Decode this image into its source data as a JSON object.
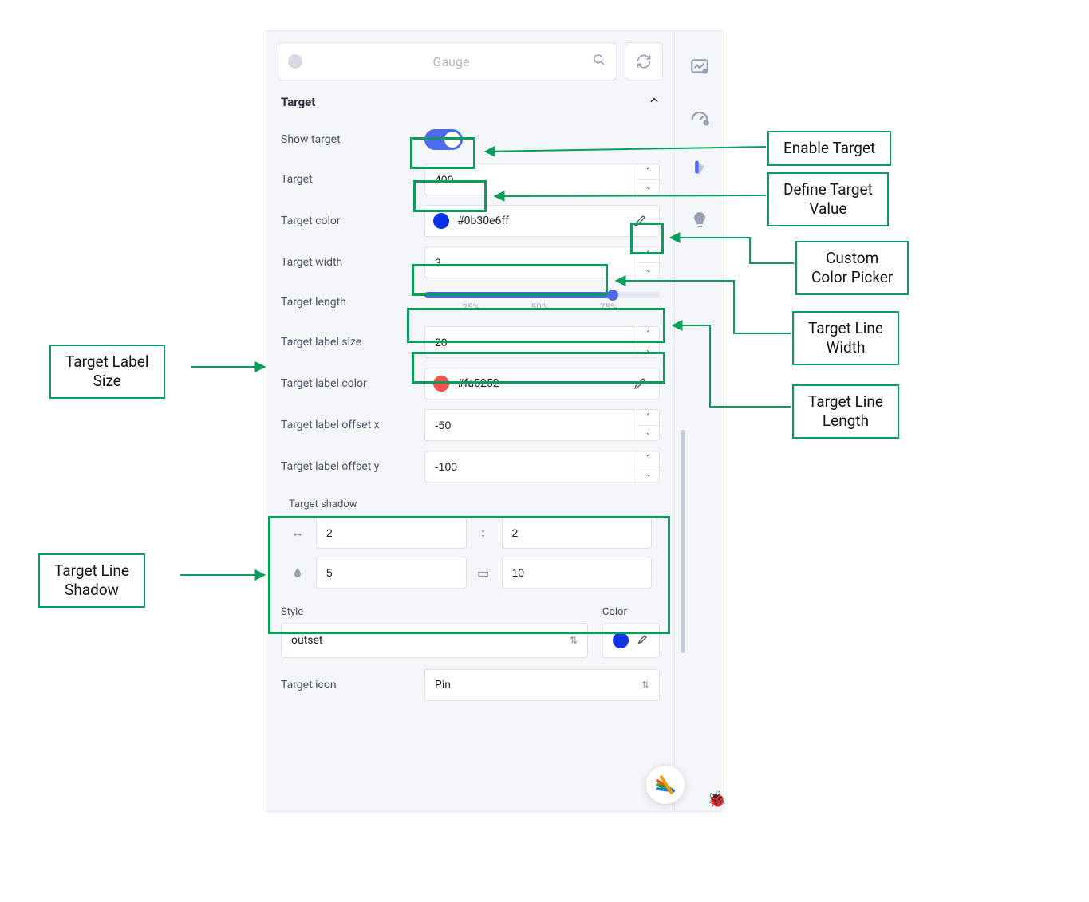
{
  "header": {
    "chart_type": "Gauge"
  },
  "section": {
    "title": "Target"
  },
  "props": {
    "show_target_label": "Show target",
    "target_label": "Target",
    "target_value": "400",
    "target_color_label": "Target color",
    "target_color_value": "#0b30e6ff",
    "target_color_swatch": "#0b30e6",
    "target_width_label": "Target width",
    "target_width_value": "3",
    "target_length_label": "Target length",
    "slider_ticks": {
      "t1": "25%",
      "t2": "50%",
      "t3": "75%"
    },
    "slider_percent": 80,
    "target_label_size_label": "Target label size",
    "target_label_size_value": "20",
    "target_label_color_label": "Target label color",
    "target_label_color_value": "#fa5252",
    "target_label_color_swatch": "#fa5252",
    "offset_x_label": "Target label offset x",
    "offset_x_value": "-50",
    "offset_y_label": "Target label offset y",
    "offset_y_value": "-100",
    "shadow_title": "Target shadow",
    "shadow_h": "2",
    "shadow_v": "2",
    "shadow_blur": "5",
    "shadow_spread": "10",
    "style_label": "Style",
    "style_value": "outset",
    "color_label": "Color",
    "style_color_swatch": "#1433e6",
    "target_icon_label": "Target icon",
    "target_icon_value": "Pin"
  },
  "callouts": {
    "enable": "Enable Target",
    "define": "Define Target\nValue",
    "picker": "Custom\nColor Picker",
    "width": "Target Line\nWidth",
    "length": "Target Line\nLength",
    "label_size": "Target Label\nSize",
    "shadow": "Target Line\nShadow"
  }
}
